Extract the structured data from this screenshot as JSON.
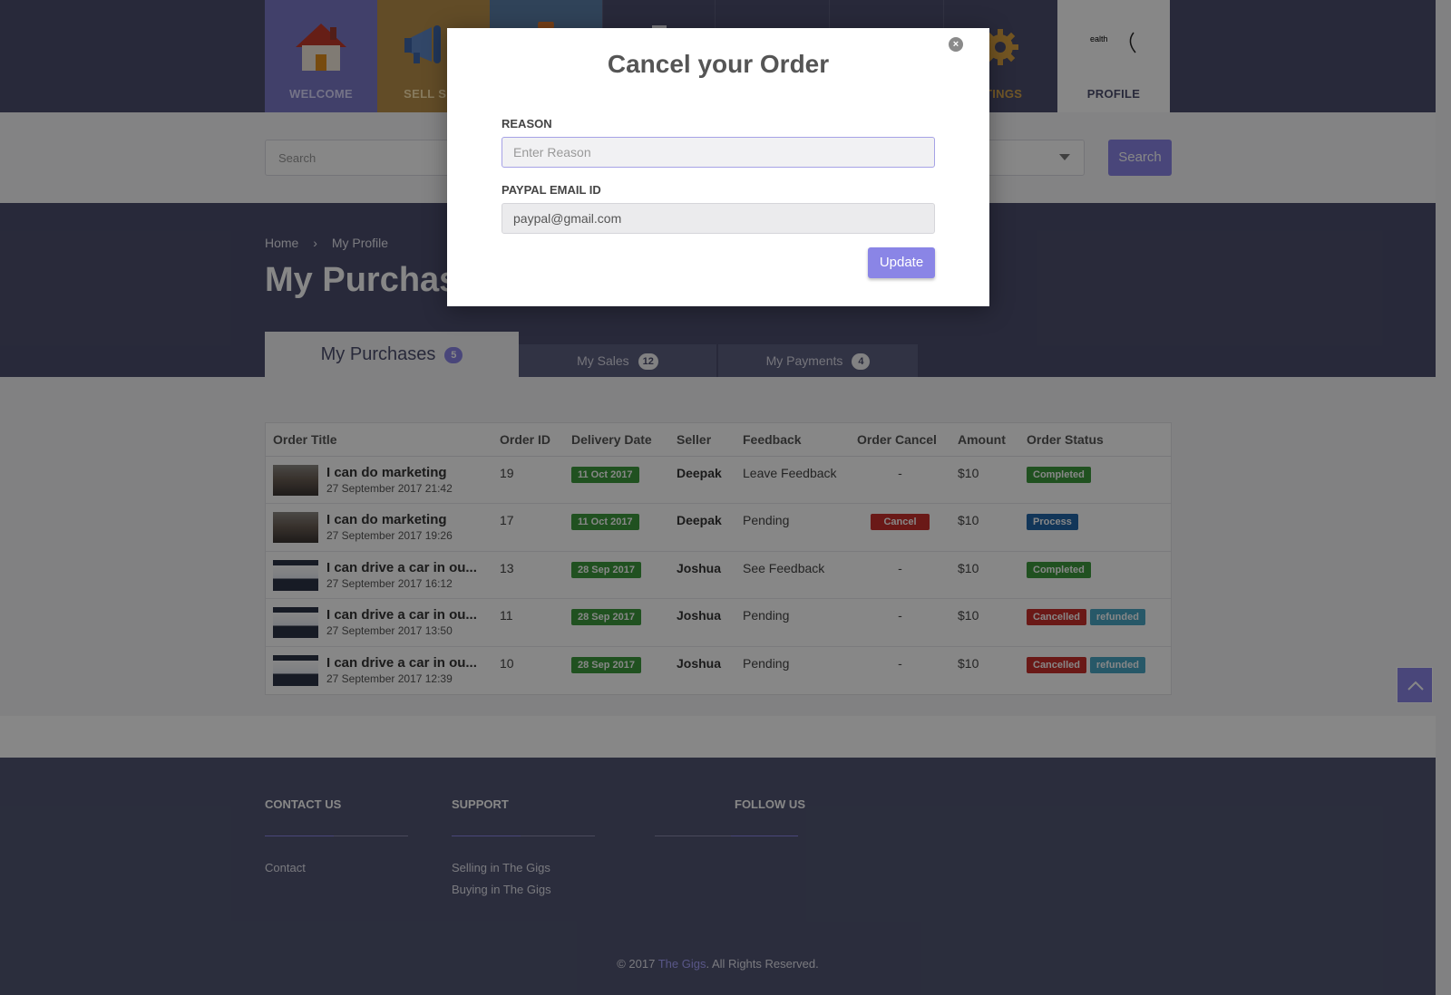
{
  "nav": {
    "items": [
      {
        "label": "WELCOME",
        "icon": "house-icon"
      },
      {
        "label": "SELL SERVICES",
        "icon": "megaphone-icon"
      },
      {
        "label": "",
        "icon": "nav-icon-3"
      },
      {
        "label": "",
        "icon": "nav-icon-4"
      },
      {
        "label": "",
        "icon": "nav-icon-5"
      },
      {
        "label": "",
        "icon": "nav-icon-6"
      },
      {
        "label": "SETTINGS",
        "icon": "gear-icon"
      },
      {
        "label": "PROFILE",
        "icon": "profile-avatar"
      }
    ],
    "welcome_label": "WELCOME",
    "sell_label": "SELL SER",
    "settings_label": "TTINGS",
    "profile_label": "PROFILE",
    "profile_avatar_text": "ealth"
  },
  "search": {
    "placeholder": "Search",
    "button_label": "Search"
  },
  "breadcrumb": {
    "home": "Home",
    "separator": "›",
    "current": "My Profile"
  },
  "page_title": "My Purchas",
  "tabs": {
    "purchases": {
      "label": "My Purchases",
      "count": "5"
    },
    "sales": {
      "label": "My Sales",
      "count": "12"
    },
    "payments": {
      "label": "My Payments",
      "count": "4"
    }
  },
  "table": {
    "headers": [
      "Order Title",
      "Order ID",
      "Delivery Date",
      "Seller",
      "Feedback",
      "Order Cancel",
      "Amount",
      "Order Status"
    ],
    "rows": [
      {
        "title": "I can do marketing",
        "date": "27 September 2017 21:42",
        "thumb": "a",
        "id": "19",
        "delivery": "11 Oct 2017",
        "seller": "Deepak",
        "feedback": "Leave Feedback",
        "cancel": "-",
        "amount": "$10",
        "status": "Completed",
        "status2": ""
      },
      {
        "title": "I can do marketing",
        "date": "27 September 2017 19:26",
        "thumb": "a",
        "id": "17",
        "delivery": "11 Oct 2017",
        "seller": "Deepak",
        "feedback": "Pending",
        "cancel": "Cancel",
        "amount": "$10",
        "status": "Process",
        "status2": ""
      },
      {
        "title": "I can drive a car in ou...",
        "date": "27 September 2017 16:12",
        "thumb": "b",
        "id": "13",
        "delivery": "28 Sep 2017",
        "seller": "Joshua",
        "feedback": "See Feedback",
        "cancel": "-",
        "amount": "$10",
        "status": "Completed",
        "status2": ""
      },
      {
        "title": "I can drive a car in ou...",
        "date": "27 September 2017 13:50",
        "thumb": "b",
        "id": "11",
        "delivery": "28 Sep 2017",
        "seller": "Joshua",
        "feedback": "Pending",
        "cancel": "-",
        "amount": "$10",
        "status": "Cancelled",
        "status2": "refunded"
      },
      {
        "title": "I can drive a car in ou...",
        "date": "27 September 2017 12:39",
        "thumb": "b",
        "id": "10",
        "delivery": "28 Sep 2017",
        "seller": "Joshua",
        "feedback": "Pending",
        "cancel": "-",
        "amount": "$10",
        "status": "Cancelled",
        "status2": "refunded"
      }
    ]
  },
  "footer": {
    "contact": {
      "heading": "CONTACT US",
      "link": "Contact"
    },
    "support": {
      "heading": "SUPPORT",
      "links": [
        "Selling in The Gigs",
        "Buying in The Gigs"
      ]
    },
    "follow": {
      "heading": "FOLLOW US"
    },
    "copyright_prefix": "© 2017 ",
    "brand": "The Gigs",
    "copyright_suffix": ". All Rights Reserved."
  },
  "modal": {
    "title": "Cancel your Order",
    "close_symbol": "×",
    "reason_label": "REASON",
    "reason_placeholder": "Enter Reason",
    "email_label": "PAYPAL EMAIL ID",
    "email_value": "paypal@gmail.com",
    "update_label": "Update"
  },
  "colors": {
    "nav_bg": "#4d4f6e",
    "accent": "#8a85e6",
    "completed": "#3e9a3e",
    "cancelled": "#c9302c",
    "process": "#2266a8",
    "refunded": "#4aa6c4"
  }
}
